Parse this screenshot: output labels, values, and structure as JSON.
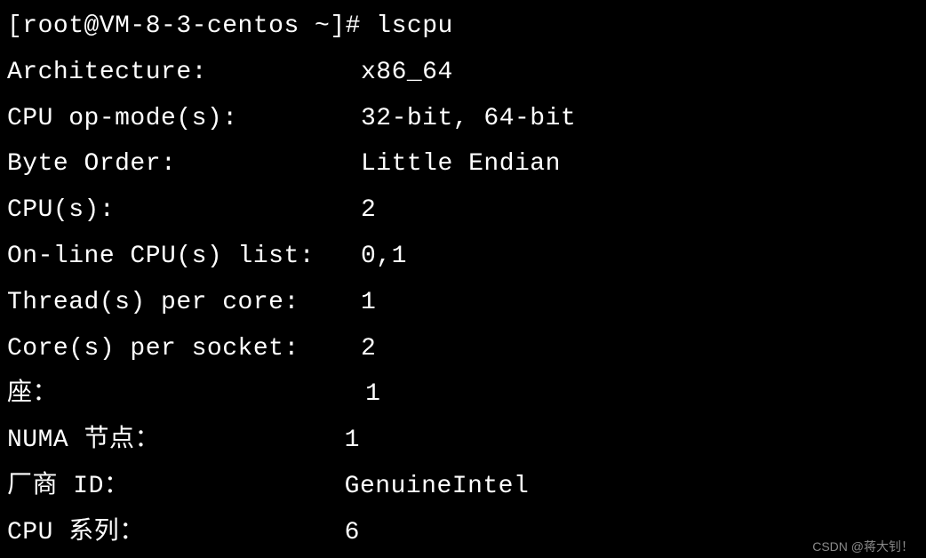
{
  "prompt": {
    "user_host": "[root@VM-8-3-centos ~]#",
    "command": "lscpu"
  },
  "output": {
    "lines": [
      {
        "label": "Architecture:          ",
        "value": "x86_64"
      },
      {
        "label": "CPU op-mode(s):        ",
        "value": "32-bit, 64-bit"
      },
      {
        "label": "Byte Order:            ",
        "value": "Little Endian"
      },
      {
        "label": "CPU(s):                ",
        "value": "2"
      },
      {
        "label": "On-line CPU(s) list:   ",
        "value": "0,1"
      },
      {
        "label": "Thread(s) per core:    ",
        "value": "1"
      },
      {
        "label": "Core(s) per socket:    ",
        "value": "2"
      },
      {
        "label": "座：                   ",
        "value": " 1"
      },
      {
        "label": "NUMA 节点：         ",
        "value": "   1"
      },
      {
        "label": "厂商 ID：           ",
        "value": "   GenuineIntel"
      },
      {
        "label": "CPU 系列：          ",
        "value": "   6"
      }
    ]
  },
  "watermark": "CSDN @蒋大钊！"
}
